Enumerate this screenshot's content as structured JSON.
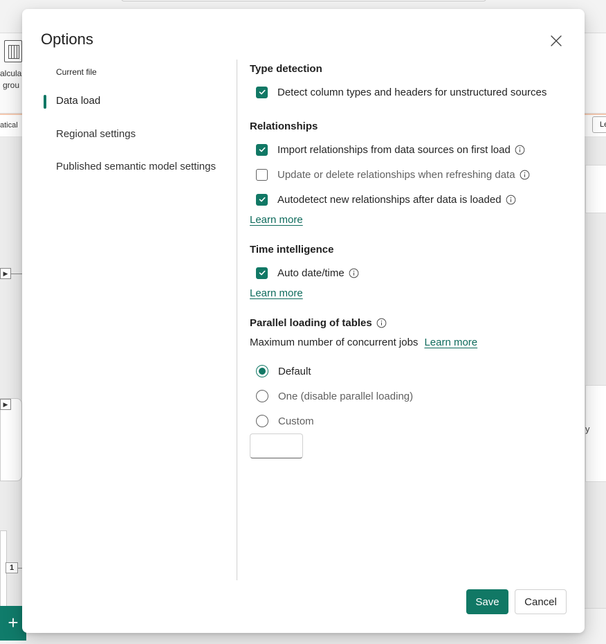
{
  "background": {
    "ribbon_label_1": "alcula",
    "ribbon_label_2": "grou",
    "formula_label": "atical",
    "right_button_label": "Le",
    "card_text": "y",
    "page_number": "1",
    "add_label": "+"
  },
  "dialog": {
    "title": "Options",
    "close_label": "Close"
  },
  "nav": {
    "header": "Current file",
    "items": [
      {
        "label": "Data load",
        "active": true
      },
      {
        "label": "Regional settings",
        "active": false
      },
      {
        "label": "Published semantic model settings",
        "active": false
      }
    ]
  },
  "sections": {
    "type_detection": {
      "title": "Type detection",
      "options": [
        {
          "label": "Detect column types and headers for unstructured sources",
          "checked": true
        }
      ]
    },
    "relationships": {
      "title": "Relationships",
      "options": [
        {
          "label": "Import relationships from data sources on first load",
          "checked": true,
          "info": true
        },
        {
          "label": "Update or delete relationships when refreshing data",
          "checked": false,
          "info": true
        },
        {
          "label": "Autodetect new relationships after data is loaded",
          "checked": true,
          "info": true
        }
      ],
      "learn_more": "Learn more"
    },
    "time_intelligence": {
      "title": "Time intelligence",
      "options": [
        {
          "label": "Auto date/time",
          "checked": true,
          "info": true
        }
      ],
      "learn_more": "Learn more"
    },
    "parallel_loading": {
      "title": "Parallel loading of tables",
      "description": "Maximum number of concurrent jobs",
      "learn_more": "Learn more",
      "options": [
        {
          "label": "Default",
          "selected": true
        },
        {
          "label": "One (disable parallel loading)",
          "selected": false
        },
        {
          "label": "Custom",
          "selected": false
        }
      ],
      "custom_value": ""
    }
  },
  "footer": {
    "save_label": "Save",
    "cancel_label": "Cancel"
  },
  "colors": {
    "accent": "#117865",
    "link": "#0e6b5c"
  }
}
